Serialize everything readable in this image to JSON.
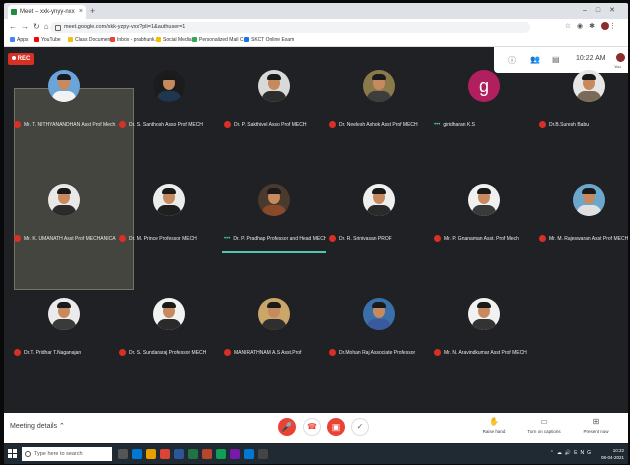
{
  "browser": {
    "tab_title": "Meet – xxk-ynyy-nxx",
    "url": "meet.google.com/xkk-yzpy-vxx?pli=1&authuser=1",
    "bookmarks": [
      "Apps",
      "YouTube",
      "Class Documents",
      "Inbox - prabhunk...",
      "Social Media",
      "Personalized Mail C...",
      "SKCT Online Exam"
    ]
  },
  "meet": {
    "rec_label": "REC",
    "time": "10:22 AM",
    "you_label": "You",
    "participants": [
      {
        "name": "Mr. T. NITHYANANDHAN Asst Prof Mech...",
        "muted": true,
        "type": "photo",
        "bg": "#6aa4d8",
        "shirt": "#f2f2f2"
      },
      {
        "name": "Dr. S. Santhosh Asso Prof MECH",
        "muted": true,
        "type": "photo",
        "bg": "#1c1c1c",
        "shirt": "#1f3550"
      },
      {
        "name": "Dr. P. Sakthivel Asso Prof MECH",
        "muted": true,
        "type": "photo",
        "bg": "#d9d9d9",
        "shirt": "#2d2d2d"
      },
      {
        "name": "Dr. Neelesh Ashok Asst Prof MECH",
        "muted": true,
        "type": "photo",
        "bg": "#8a7a4a",
        "shirt": "#3d3d3d"
      },
      {
        "name": "giridharan K.S",
        "muted": false,
        "type": "letter",
        "letter": "g"
      },
      {
        "name": "Dr.B.Suresh Babu",
        "muted": true,
        "type": "photo",
        "bg": "#e6e6e6",
        "shirt": "#7a6a5a"
      },
      {
        "name": "Mr. K. UMANATH Asst Prof MECHANICAL",
        "muted": true,
        "type": "photo",
        "bg": "#e8e8e8",
        "shirt": "#2b2b2b"
      },
      {
        "name": "Dr. M. Prince Professor MECH",
        "muted": true,
        "type": "photo",
        "bg": "#ececec",
        "shirt": "#1f1f1f"
      },
      {
        "name": "Dr. P. Pradhap Professor and Head MECH",
        "muted": false,
        "type": "photo",
        "bg": "#4a3a2e",
        "shirt": "#8a4a2a"
      },
      {
        "name": "Dr. R. Srinivasan PROF",
        "muted": true,
        "type": "photo",
        "bg": "#efefef",
        "shirt": "#2a2a2a"
      },
      {
        "name": "Mr. P. Gnanaman Asst. Prof Mech",
        "muted": true,
        "type": "photo",
        "bg": "#f0f0f0",
        "shirt": "#3a3a3a"
      },
      {
        "name": "Mr. M. Rajeswaran Asst Prof MECH",
        "muted": true,
        "type": "photo",
        "bg": "#6ba6cc",
        "shirt": "#e0e0e0"
      },
      {
        "name": "Dr.T. Pridhar T.Naganajan",
        "muted": true,
        "type": "photo",
        "bg": "#ebebeb",
        "shirt": "#3a3a3a"
      },
      {
        "name": "Dr. S. Sundararaj Professor MECH",
        "muted": true,
        "type": "photo",
        "bg": "#f2f2f2",
        "shirt": "#2a2a2a"
      },
      {
        "name": "MANIRATHNAM A.S Asst.Prof",
        "muted": true,
        "type": "photo",
        "bg": "#caa668",
        "shirt": "#2f2f2f"
      },
      {
        "name": "Dr.Mohan Raj Associate Professor",
        "muted": true,
        "type": "photo",
        "bg": "#3a6fa8",
        "shirt": "#3a5aa0"
      },
      {
        "name": "Mr. N. Aravindkumar Asst Prof MECH",
        "muted": true,
        "type": "photo",
        "bg": "#f1f1f1",
        "shirt": "#333333"
      }
    ],
    "controls": {
      "meeting_details": "Meeting details",
      "raise_hand": "Raise hand",
      "captions": "Turn on captions",
      "present": "Present now"
    }
  },
  "taskbar": {
    "search_placeholder": "Type here to search",
    "time": "10:22",
    "date": "08-04-2021",
    "lang": "ENG"
  }
}
